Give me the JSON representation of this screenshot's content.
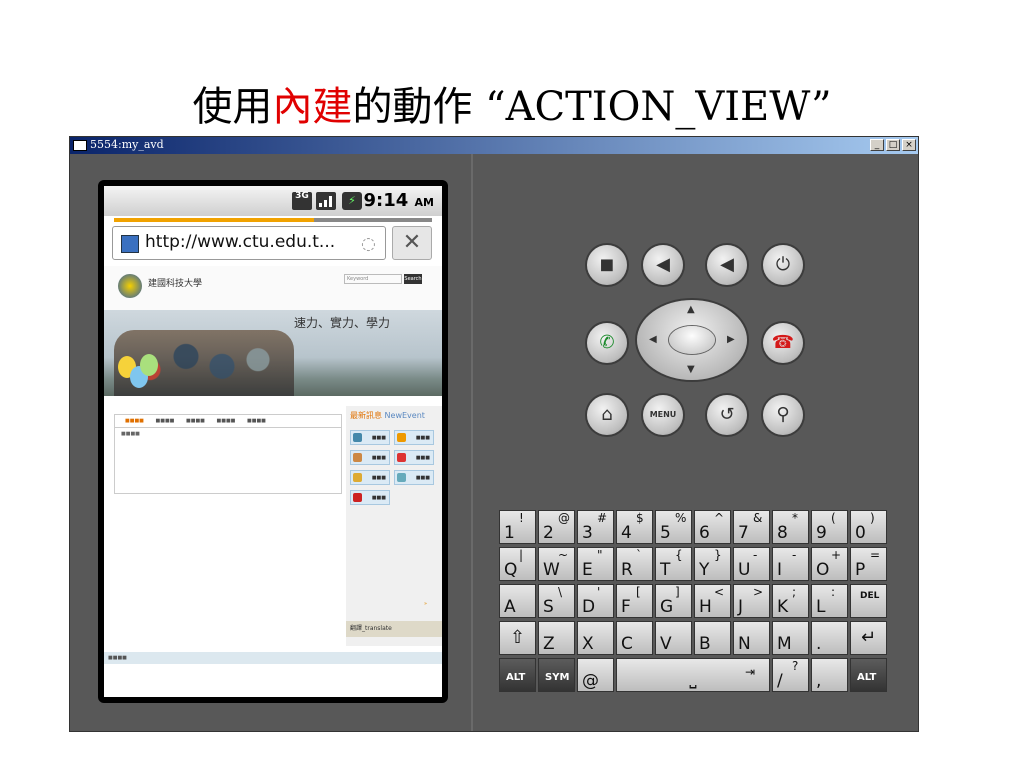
{
  "slide": {
    "title_pre": "使用",
    "title_red": "內建",
    "title_post": "的動作 “ACTION_VIEW”"
  },
  "window": {
    "title": "5554:my_avd",
    "controls": [
      "_",
      "□",
      "×"
    ]
  },
  "status_bar": {
    "network": "3G",
    "time": "9:14",
    "ampm": "AM"
  },
  "browser": {
    "url": "http://www.ctu.edu.t...",
    "load_progress": 0.63
  },
  "webpage": {
    "school_name": "建國科技大學",
    "slogan": "速力、實力、學力",
    "search_placeholder": "Keyword",
    "search_button": "Search",
    "side_title_a": "最新訊息",
    "side_title_b": "NewEvent",
    "translate": "翻譯_translate"
  },
  "right_panel": {
    "menu_label": "MENU"
  },
  "keyboard": {
    "rows": [
      [
        [
          "1",
          "!"
        ],
        [
          "2",
          "@"
        ],
        [
          "3",
          "#"
        ],
        [
          "4",
          "$"
        ],
        [
          "5",
          "%"
        ],
        [
          "6",
          "^"
        ],
        [
          "7",
          "&"
        ],
        [
          "8",
          "*"
        ],
        [
          "9",
          "("
        ],
        [
          "0",
          ")"
        ]
      ],
      [
        [
          "Q",
          "|"
        ],
        [
          "W",
          "~"
        ],
        [
          "E",
          "\""
        ],
        [
          "R",
          "`"
        ],
        [
          "T",
          "{"
        ],
        [
          "Y",
          "}"
        ],
        [
          "U",
          "-"
        ],
        [
          "I",
          "-"
        ],
        [
          "O",
          "+"
        ],
        [
          "P",
          "="
        ]
      ],
      [
        [
          "A",
          ""
        ],
        [
          "S",
          "\\"
        ],
        [
          "D",
          "'"
        ],
        [
          "F",
          "["
        ],
        [
          "G",
          "]"
        ],
        [
          "H",
          "<"
        ],
        [
          "J",
          ">"
        ],
        [
          "K",
          ";"
        ],
        [
          "L",
          ":"
        ],
        [
          "DEL",
          ""
        ]
      ]
    ],
    "row4": [
      "⇧",
      "Z",
      "X",
      "C",
      "V",
      "B",
      "N",
      "M",
      ".",
      "↵"
    ],
    "alt": "ALT",
    "sym": "SYM",
    "at": "@",
    "slash": "/",
    "question": "?",
    "comma": ","
  }
}
